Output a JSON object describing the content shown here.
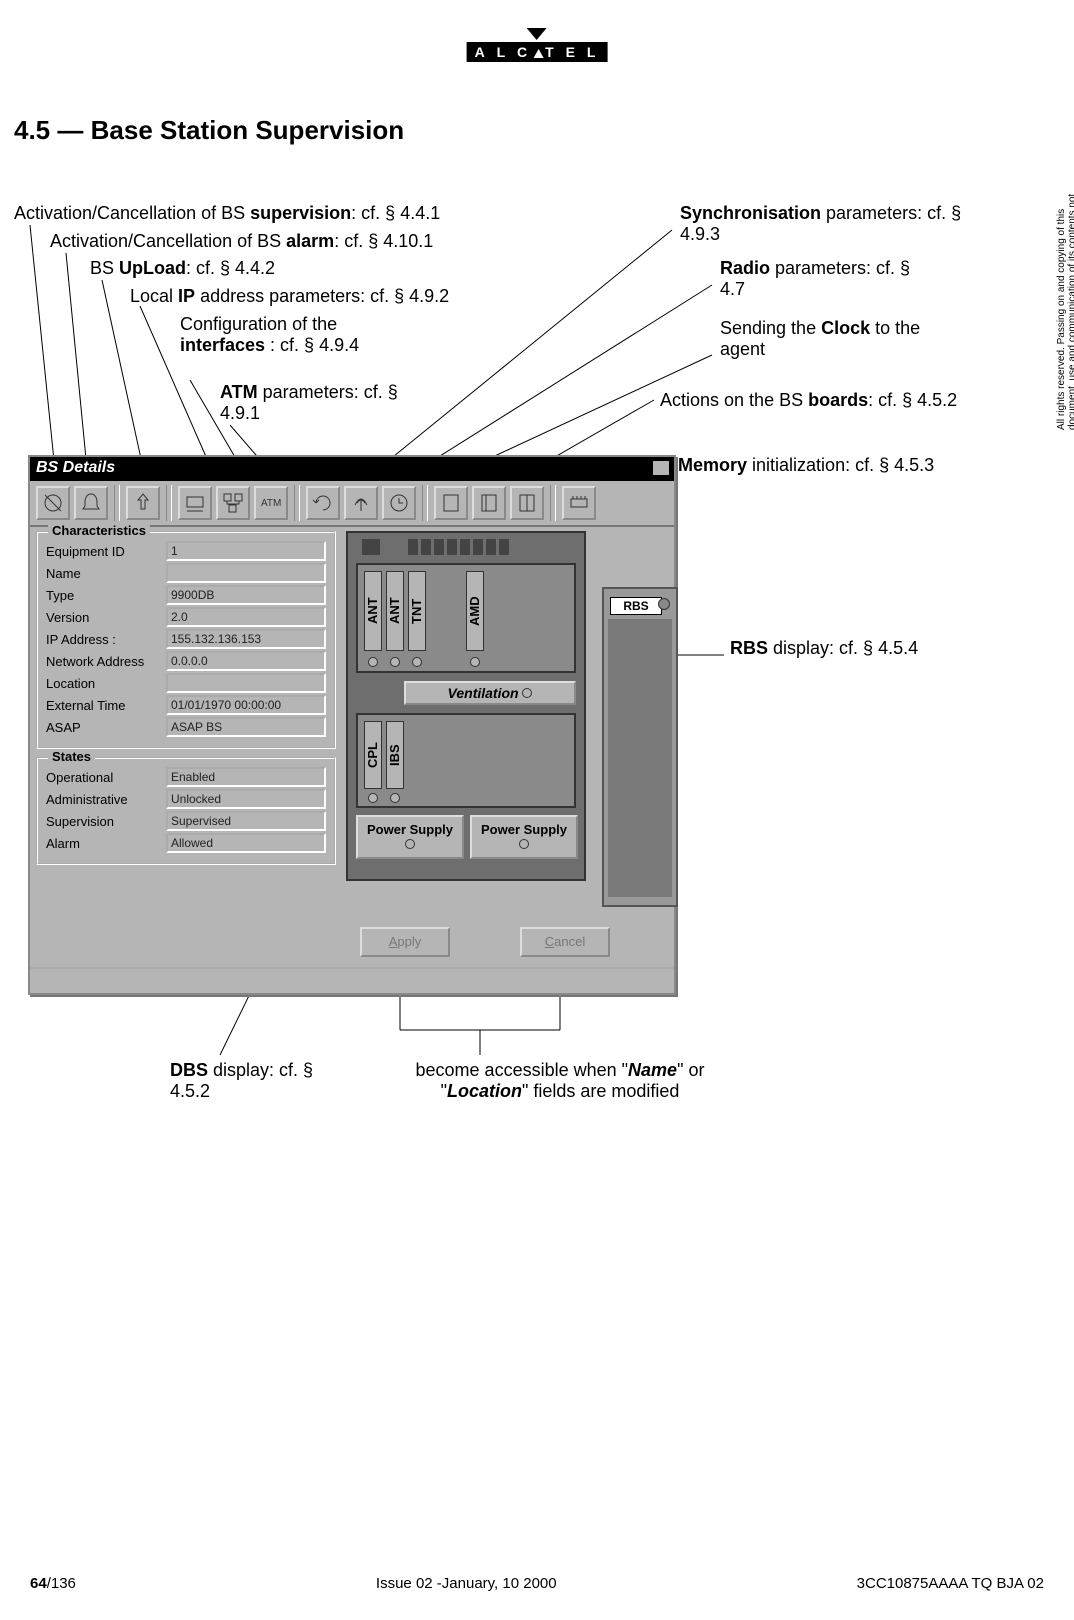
{
  "logo": "ALCATEL",
  "section": {
    "num": "4.5",
    "sep": "—",
    "title": "Base Station Supervision"
  },
  "copyright": "All rights reserved. Passing on and copying of this document, use and communication of its contents not permitted without written authorization from ALCATEL",
  "callouts": {
    "c1a": "Activation/Cancellation of BS ",
    "c1b": "supervision",
    "c1c": ": cf. § 4.4.1",
    "c2a": "Activation/Cancellation of BS ",
    "c2b": "alarm",
    "c2c": ": cf. § 4.10.1",
    "c3a": "BS ",
    "c3b": "UpLoad",
    "c3c": ": cf. § 4.4.2",
    "c4a": "Local ",
    "c4b": "IP",
    "c4c": " address parameters: cf. § 4.9.2",
    "c5a": "Configuration of the ",
    "c5b": "interfaces",
    "c5c": " : cf. § 4.9.4",
    "c6a": "ATM",
    "c6b": " parameters: cf. § 4.9.1",
    "c7a": "Synchronisation",
    "c7b": " parameters: cf. § 4.9.3",
    "c8a": "Radio",
    "c8b": " parameters: cf. § 4.7",
    "c9a": "Sending the ",
    "c9b": "Clock",
    "c9c": " to the agent",
    "c10a": "Actions on the BS  ",
    "c10b": "boards",
    "c10c": ": cf. § 4.5.2",
    "c11a": "Memory",
    "c11b": " initialization: cf. § 4.5.3",
    "c12a": "RBS",
    "c12b": " display: cf. § 4.5.4",
    "c13a": "DBS",
    "c13b": " display: cf. § 4.5.2",
    "c14a": "become accessible when \"",
    "c14b": "Name",
    "c14c": "\" or \"",
    "c14d": "Location",
    "c14e": "\" fields are modified"
  },
  "window": {
    "title": "BS Details",
    "group1": "Characteristics",
    "group2": "States",
    "labels": {
      "equipId": "Equipment ID",
      "name": "Name",
      "type": "Type",
      "version": "Version",
      "ip": "IP Address :",
      "net": "Network Address",
      "loc": "Location",
      "ext": "External Time",
      "asap": "ASAP",
      "op": "Operational",
      "admin": "Administrative",
      "sup": "Supervision",
      "alarm": "Alarm"
    },
    "values": {
      "equipId": "1",
      "name": "",
      "type": "9900DB",
      "version": "2.0",
      "ip": "155.132.136.153",
      "net": "0.0.0.0",
      "loc": "",
      "ext": "01/01/1970 00:00:00",
      "asap": "ASAP BS",
      "op": "Enabled",
      "admin": "Unlocked",
      "sup": "Supervised",
      "alarm": "Allowed"
    },
    "buttons": {
      "apply": "Apply",
      "cancel": "Cancel"
    },
    "diagram": {
      "ant": "ANT",
      "tnt": "TNT",
      "amd": "AMD",
      "cpl": "CPL",
      "ibs": "IBS",
      "vent": "Ventilation",
      "ps": "Power Supply",
      "rbs": "RBS"
    }
  },
  "footer": {
    "page": "64",
    "pages": "/136",
    "issue": "Issue 02 -January, 10 2000",
    "doc": "3CC10875AAAA TQ BJA 02"
  }
}
